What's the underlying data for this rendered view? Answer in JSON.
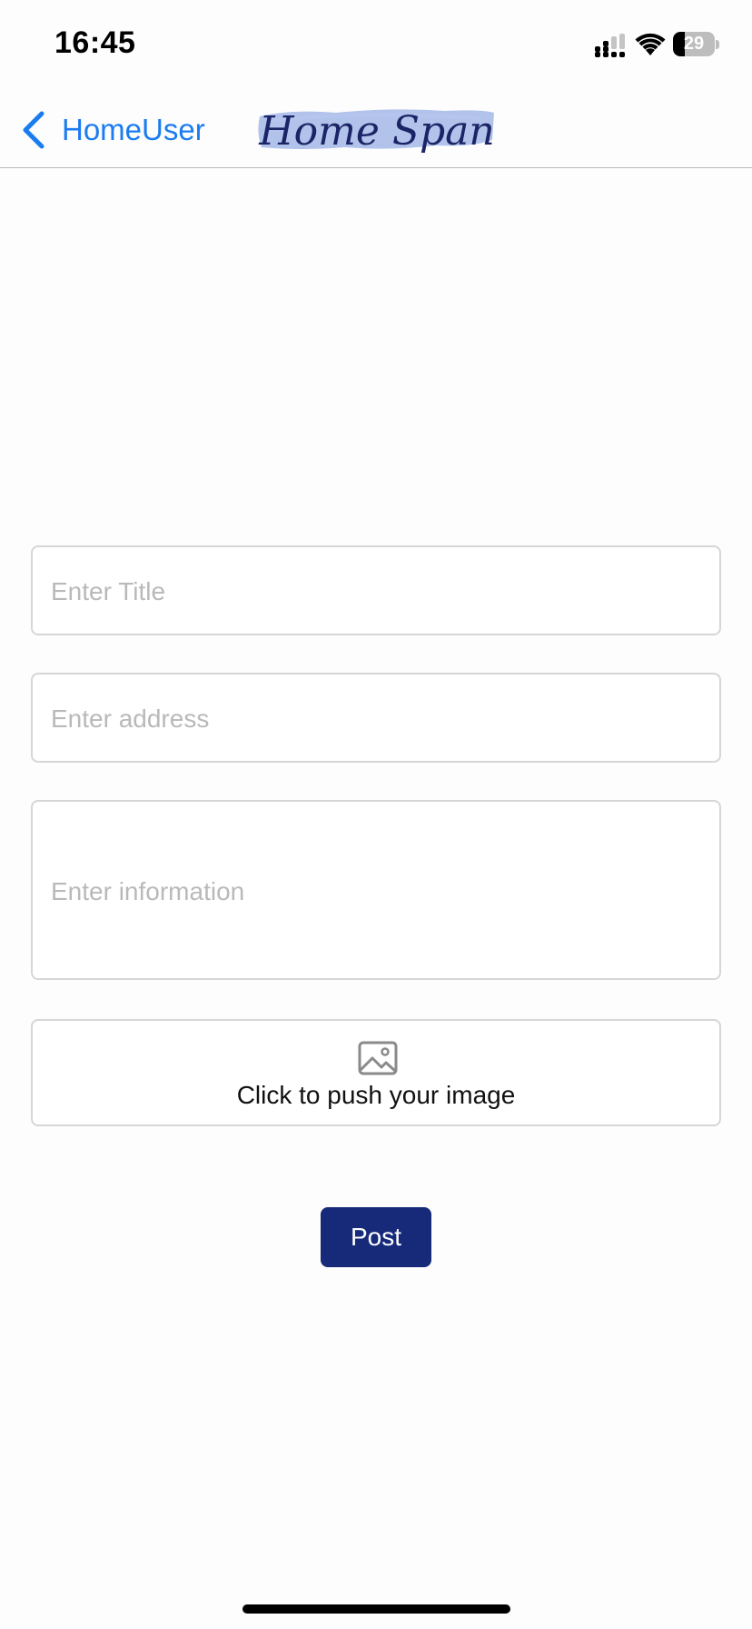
{
  "status_bar": {
    "time": "16:45",
    "battery_level": "29",
    "battery_fraction": 0.29,
    "icons": [
      "cellular-signal-icon",
      "wifi-icon",
      "battery-icon"
    ]
  },
  "nav": {
    "back_label": "HomeUser",
    "logo_text": "Home Span",
    "back_color": "#1b7cf0",
    "logo_highlight_color": "#9fb4e6"
  },
  "form": {
    "title_placeholder": "Enter Title",
    "address_placeholder": "Enter address",
    "info_placeholder": "Enter information",
    "image_upload_label": "Click to push your image",
    "post_label": "Post",
    "post_button_color": "#162a79"
  }
}
